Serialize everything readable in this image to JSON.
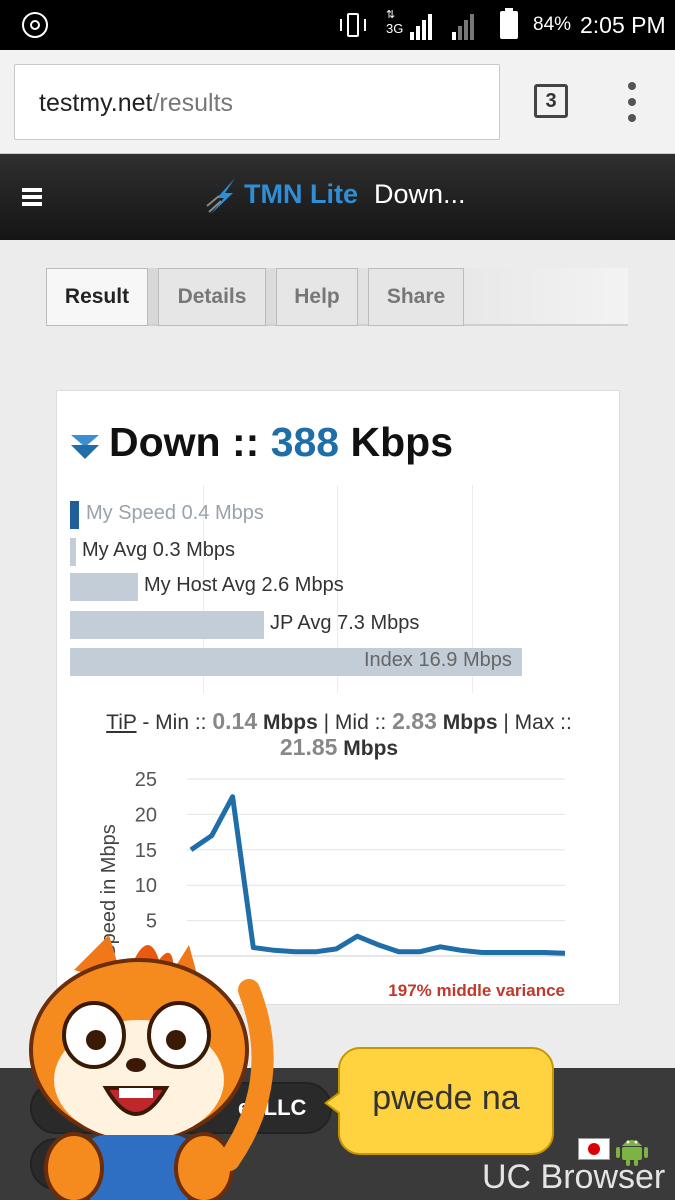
{
  "status_bar": {
    "network": "3G",
    "battery": "84%",
    "time": "2:05 PM"
  },
  "browser": {
    "url_host": "testmy.net",
    "url_path": "/results",
    "tab_count": "3"
  },
  "site": {
    "brand": "TMN Lite",
    "page_title": "Down...",
    "brand_color": "#2e8fd6"
  },
  "tabs": [
    "Result",
    "Details",
    "Help",
    "Share"
  ],
  "result": {
    "heading_prefix": "Down :: ",
    "speed_value": "388",
    "speed_unit": " Kbps",
    "accent_color": "#1f6ea8"
  },
  "comparison": {
    "my_speed": "My Speed 0.4 Mbps",
    "my_avg": "My Avg 0.3 Mbps",
    "host_avg": "My Host Avg 2.6 Mbps",
    "jp_avg": "JP Avg 7.3 Mbps",
    "index": "Index 16.9 Mbps",
    "values_mbps": [
      0.4,
      0.3,
      2.6,
      7.3,
      16.9
    ]
  },
  "tip": {
    "label": "TiP",
    "min_prefix": " - Min :: ",
    "min": "0.14",
    "mid_prefix": " | Mid :: ",
    "mid": "2.83",
    "max_prefix": " | Max :: ",
    "max": "21.85",
    "unit": "Mbps"
  },
  "chart_data": {
    "type": "line",
    "ylabel": "Speed in Mbps",
    "ylim": [
      0,
      25
    ],
    "y_ticks": [
      "25",
      "20",
      "15",
      "10",
      "5"
    ],
    "values": [
      15,
      17,
      22.5,
      1.2,
      0.8,
      0.6,
      0.6,
      1.0,
      2.8,
      1.6,
      0.6,
      0.6,
      1.3,
      0.8,
      0.5,
      0.5,
      0.5,
      0.5,
      0.4
    ],
    "series_color": "#1f6ea8",
    "annotation": "197% middle variance",
    "annotation_color": "#c0392b"
  },
  "bottom": {
    "network_label": "et LLC"
  },
  "overlay": {
    "bubble_text": "pwede na",
    "watermark": "UC Browser"
  }
}
